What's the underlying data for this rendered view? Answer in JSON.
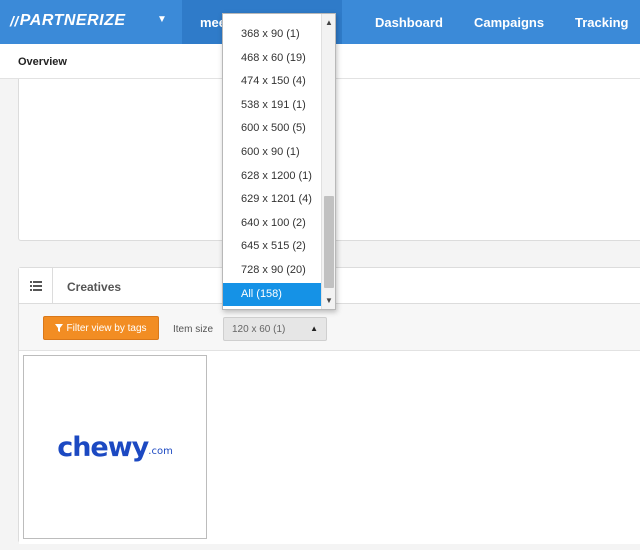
{
  "brand": {
    "name": "PARTNERIZE",
    "logo_mark": "//",
    "caret_icon": "caret-down-icon"
  },
  "account": {
    "label": "mee"
  },
  "nav": {
    "items": [
      "Dashboard",
      "Campaigns",
      "Tracking"
    ]
  },
  "subnav": {
    "active": "Overview"
  },
  "creatives": {
    "title": "Creatives",
    "list_icon": "list-icon",
    "filter_button": "Filter view by tags",
    "filter_icon": "filter-icon",
    "item_size_label": "Item size",
    "item_size_value": "120 x 60 (1)",
    "item_logo": {
      "brand": "chewy",
      "suffix": ".com"
    }
  },
  "size_dropdown": {
    "options": [
      "368 x 90 (1)",
      "468 x 60 (19)",
      "474 x 150 (4)",
      "538 x 191 (1)",
      "600 x 500 (5)",
      "600 x 90 (1)",
      "628 x 1200 (1)",
      "629 x 1201 (4)",
      "640 x 100 (2)",
      "645 x 515 (2)",
      "728 x 90 (20)",
      "All (158)"
    ],
    "highlighted": "All (158)"
  },
  "colors": {
    "topbar": "#3b8ad8",
    "account_tab": "#2f7bc9",
    "filter_button": "#f28d23",
    "dropdown_highlight": "#1592e6",
    "chewy_blue": "#1c49c2"
  }
}
